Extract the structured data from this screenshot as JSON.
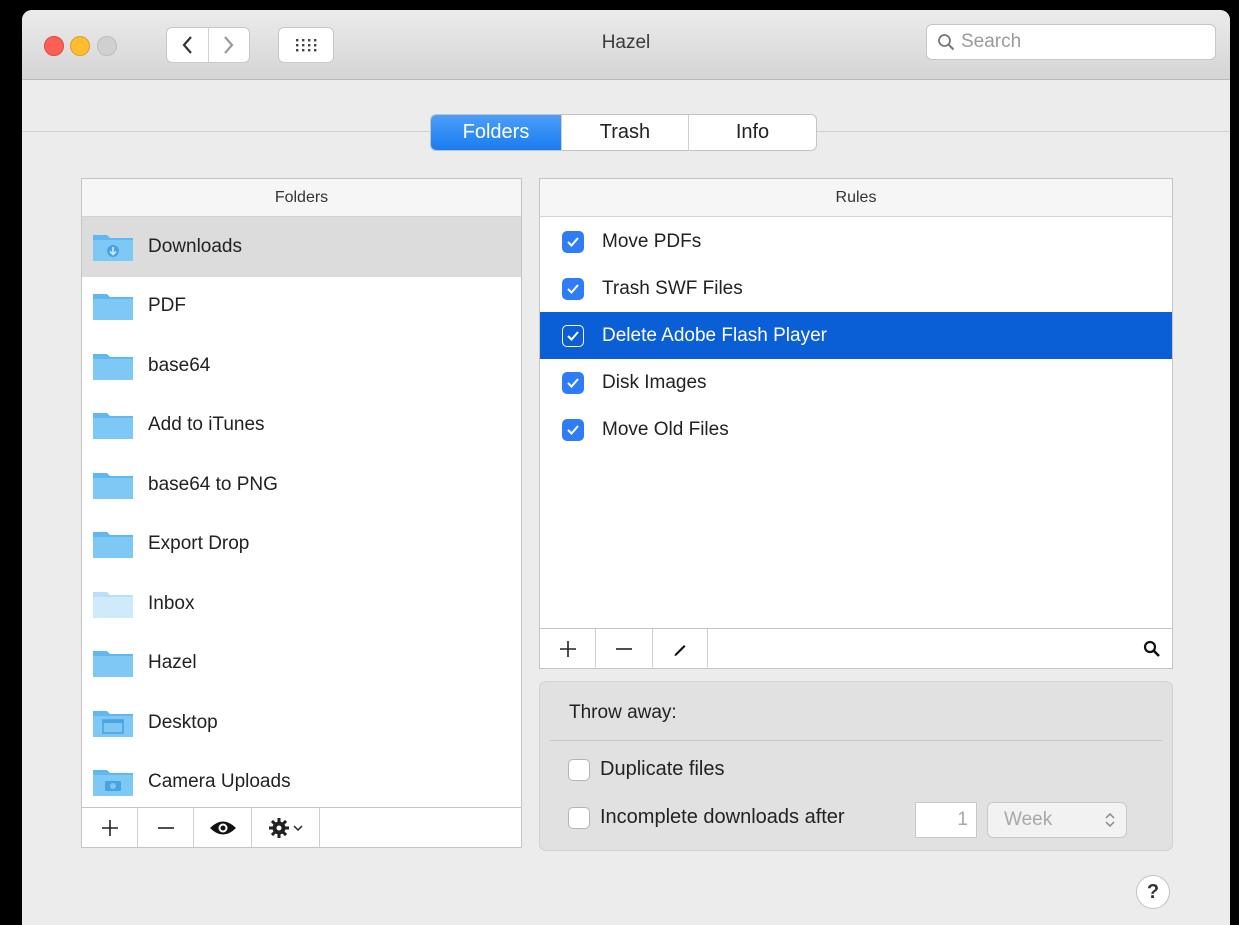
{
  "window": {
    "title": "Hazel"
  },
  "search": {
    "placeholder": "Search"
  },
  "tabs": [
    {
      "label": "Folders",
      "active": true
    },
    {
      "label": "Trash",
      "active": false
    },
    {
      "label": "Info",
      "active": false
    }
  ],
  "folders_panel": {
    "header": "Folders",
    "items": [
      {
        "label": "Downloads",
        "icon": "downloads-folder-icon",
        "selected": true
      },
      {
        "label": "PDF",
        "icon": "folder-icon"
      },
      {
        "label": "base64",
        "icon": "folder-icon"
      },
      {
        "label": "Add to iTunes",
        "icon": "folder-icon"
      },
      {
        "label": "base64 to PNG",
        "icon": "folder-icon"
      },
      {
        "label": "Export Drop",
        "icon": "folder-icon"
      },
      {
        "label": "Inbox",
        "icon": "light-folder-icon"
      },
      {
        "label": "Hazel",
        "icon": "folder-icon"
      },
      {
        "label": "Desktop",
        "icon": "desktop-folder-icon"
      },
      {
        "label": "Camera Uploads",
        "icon": "camera-folder-icon"
      }
    ]
  },
  "rules_panel": {
    "header": "Rules",
    "items": [
      {
        "label": "Move PDFs",
        "checked": true,
        "selected": false
      },
      {
        "label": "Trash SWF Files",
        "checked": true,
        "selected": false
      },
      {
        "label": "Delete Adobe Flash Player",
        "checked": true,
        "selected": true
      },
      {
        "label": "Disk Images",
        "checked": true,
        "selected": false
      },
      {
        "label": "Move Old Files",
        "checked": true,
        "selected": false
      }
    ]
  },
  "throw_away": {
    "title": "Throw away:",
    "duplicate_label": "Duplicate files",
    "incomplete_label": "Incomplete downloads after",
    "incomplete_value": "1",
    "incomplete_unit": "Week"
  },
  "help": {
    "label": "?"
  },
  "colors": {
    "accent": "#1a7cf0",
    "selection": "#0a5fd7",
    "folder": "#5fb8f0"
  }
}
